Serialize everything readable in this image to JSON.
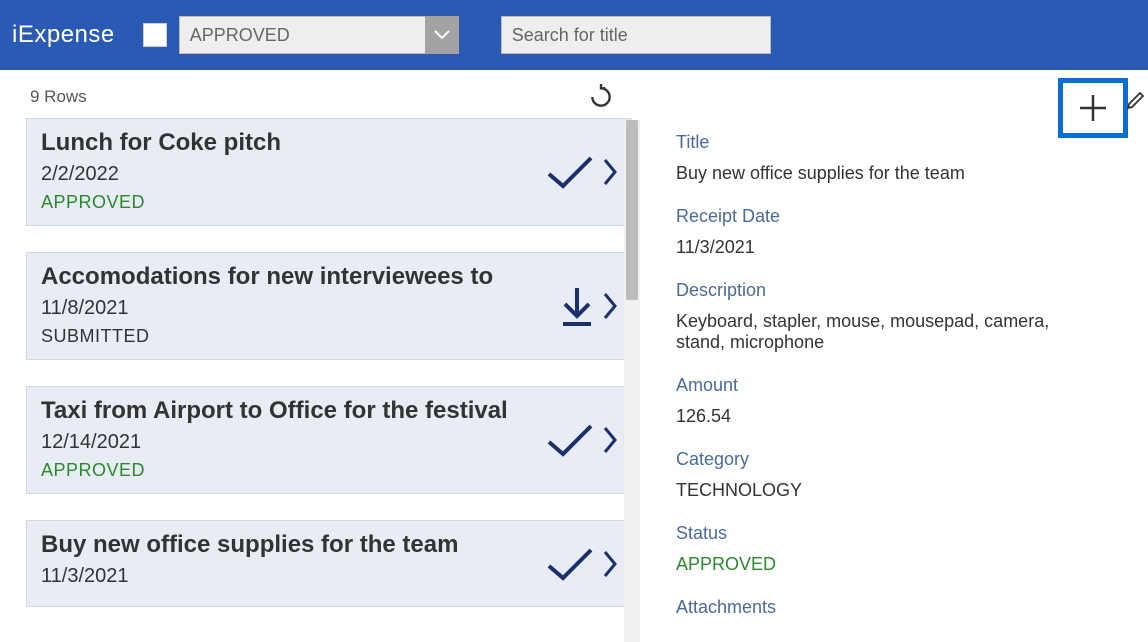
{
  "app": {
    "title": "iExpense"
  },
  "header": {
    "filter_selected": "APPROVED",
    "search_placeholder": "Search for title"
  },
  "list": {
    "rows_label": "9 Rows",
    "items": [
      {
        "title": "Lunch for Coke pitch",
        "date": "2/2/2022",
        "status": "APPROVED",
        "status_kind": "approved",
        "icon": "check"
      },
      {
        "title": "Accomodations for new interviewees to",
        "date": "11/8/2021",
        "status": "SUBMITTED",
        "status_kind": "submitted",
        "icon": "download"
      },
      {
        "title": "Taxi from Airport to Office for the festival",
        "date": "12/14/2021",
        "status": "APPROVED",
        "status_kind": "approved",
        "icon": "check"
      },
      {
        "title": "Buy new office supplies for the team",
        "date": "11/3/2021",
        "status": "",
        "status_kind": "approved",
        "icon": "check"
      }
    ]
  },
  "detail": {
    "labels": {
      "title": "Title",
      "receipt_date": "Receipt Date",
      "description": "Description",
      "amount": "Amount",
      "category": "Category",
      "status": "Status",
      "attachments": "Attachments"
    },
    "title": "Buy new office supplies for the team",
    "receipt_date": "11/3/2021",
    "description": "Keyboard, stapler, mouse, mousepad, camera, stand, microphone",
    "amount": "126.54",
    "category": "TECHNOLOGY",
    "status": "APPROVED"
  }
}
